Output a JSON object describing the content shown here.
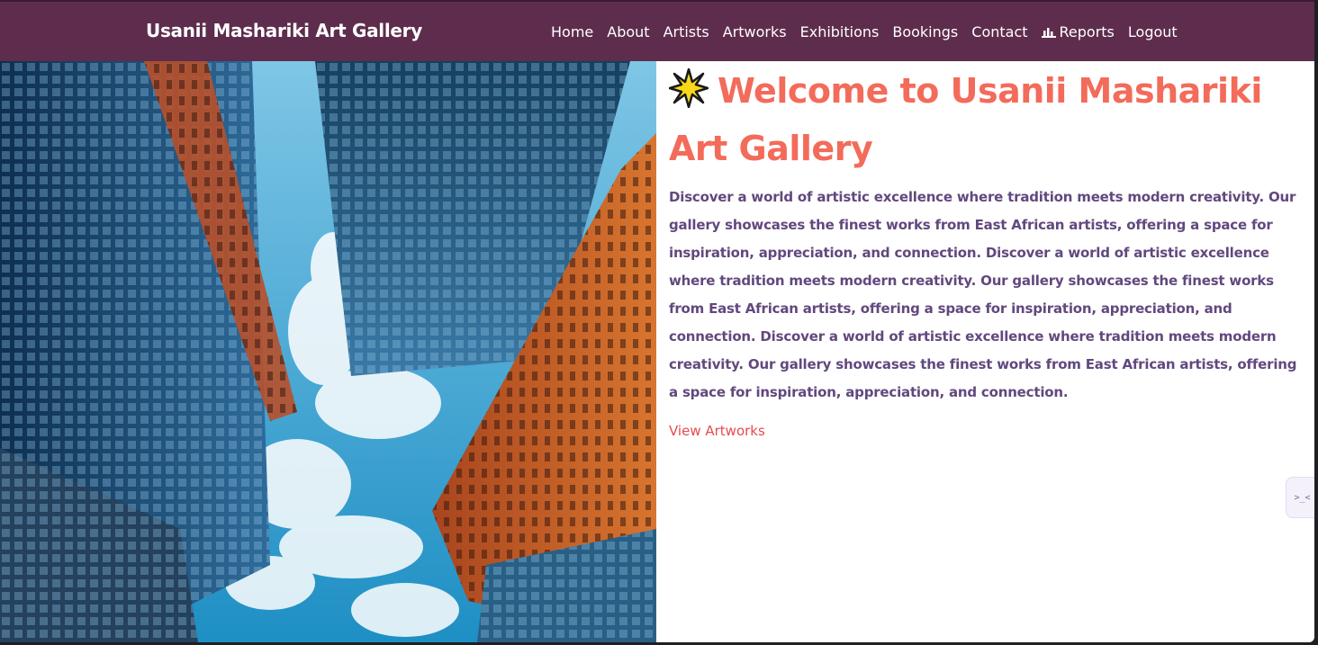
{
  "brand": "Usanii Mashariki Art Gallery",
  "nav": [
    {
      "label": "Home",
      "name": "nav-home"
    },
    {
      "label": "About",
      "name": "nav-about"
    },
    {
      "label": "Artists",
      "name": "nav-artists"
    },
    {
      "label": "Artworks",
      "name": "nav-artworks"
    },
    {
      "label": "Exhibitions",
      "name": "nav-exhibitions"
    },
    {
      "label": "Bookings",
      "name": "nav-bookings"
    },
    {
      "label": "Contact",
      "name": "nav-contact"
    },
    {
      "label": "Reports",
      "name": "nav-reports",
      "icon": "bar-chart-icon"
    },
    {
      "label": "Logout",
      "name": "nav-logout"
    }
  ],
  "hero": {
    "title": "Welcome to Usanii Mashariki Art Gallery",
    "title_icon": "sparkle-star-icon",
    "description": "Discover a world of artistic excellence where tradition meets modern creativity. Our gallery showcases the finest works from East African artists, offering a space for inspiration, appreciation, and connection. Discover a world of artistic excellence where tradition meets modern creativity. Our gallery showcases the finest works from East African artists, offering a space for inspiration, appreciation, and connection. Discover a world of artistic excellence where tradition meets modern creativity. Our gallery showcases the finest works from East African artists, offering a space for inspiration, appreciation, and connection.",
    "cta_label": "View Artworks",
    "image_icon": "city-skyline-image"
  },
  "side_widget": {
    "label": ">_<",
    "icon": "terminal-icon"
  },
  "colors": {
    "navbar": "#5e2d4d",
    "title": "#f36b5a",
    "text": "#62487e",
    "link": "#e84a4a"
  }
}
